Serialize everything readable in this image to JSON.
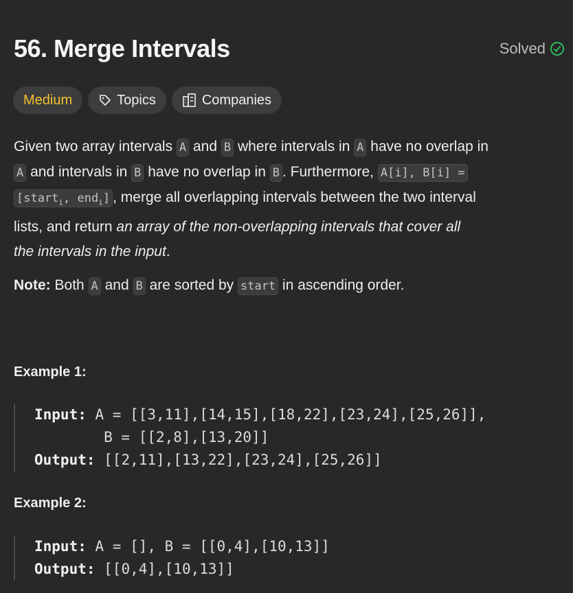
{
  "header": {
    "title": "56. Merge Intervals",
    "status": "Solved",
    "status_color": "#2cbb5d"
  },
  "tags": {
    "difficulty": "Medium",
    "topics": "Topics",
    "companies": "Companies"
  },
  "description": {
    "p1": "Given two array intervals ",
    "A": "A",
    "B": "B",
    "and1": " and ",
    "p2": " where intervals in ",
    "p3": " have no overlap in",
    "p4": " and intervals in ",
    "p5": " have no overlap in ",
    "p6": ". Furthermore, ",
    "code1": "A[i], B[i] =",
    "code2a": "[start",
    "code2b": ", end",
    "code2c": "]",
    "sub": "i",
    "p7": ", merge all overlapping intervals between the two interval",
    "p8": "lists, and return ",
    "em1": "an array of the non-overlapping intervals that cover all",
    "em2": "the intervals in the input",
    "end": "."
  },
  "note": {
    "label": "Note:",
    "t1": " Both ",
    "t2": " and ",
    "t3": " are sorted by ",
    "code": "start",
    "t4": " in ascending order."
  },
  "examples": [
    {
      "title": "Example 1:",
      "input_label": "Input:",
      "input": " A = [[3,11],[14,15],[18,22],[23,24],[25,26]],",
      "input2": "        B = [[2,8],[13,20]]",
      "output_label": "Output:",
      "output": " [[2,11],[13,22],[23,24],[25,26]]"
    },
    {
      "title": "Example 2:",
      "input_label": "Input:",
      "input": " A = [], B = [[0,4],[10,13]]",
      "output_label": "Output:",
      "output": " [[0,4],[10,13]]"
    }
  ]
}
